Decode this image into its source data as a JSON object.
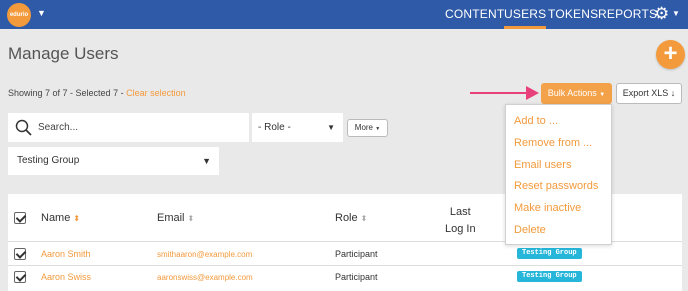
{
  "brand": {
    "logo_text": "edurio",
    "accent": "#f39a3c",
    "nav_bg": "#2f5aa8",
    "tag_color": "#26b6d9"
  },
  "nav": {
    "items": [
      {
        "label": "CONTENT",
        "active": false
      },
      {
        "label": "USERS",
        "active": true
      },
      {
        "label": "TOKENS",
        "active": false
      },
      {
        "label": "REPORTS",
        "active": false
      }
    ],
    "settings_icon": "gear-icon"
  },
  "page": {
    "title": "Manage Users",
    "add_icon": "plus-icon"
  },
  "status": {
    "showing": "Showing 7 of 7 - Selected 7 - ",
    "clear_label": "Clear selection"
  },
  "toolbar": {
    "bulk_label": "Bulk Actions",
    "export_label": "Export XLS"
  },
  "filters": {
    "search_placeholder": "Search...",
    "role_value": "- Role -",
    "more_label": "More",
    "group_value": "Testing Group"
  },
  "bulk_menu": {
    "items": [
      "Add to ...",
      "Remove from ...",
      "Email users",
      "Reset passwords",
      "Make inactive",
      "Delete"
    ]
  },
  "table": {
    "columns": {
      "name": "Name",
      "email": "Email",
      "role": "Role",
      "last_login_1": "Last",
      "last_login_2": "Log In"
    },
    "rows": [
      {
        "name": "Aaron Smith",
        "email": "smithaaron@example.com",
        "role": "Participant",
        "group": "Testing Group",
        "checked": true
      },
      {
        "name": "Aaron Swiss",
        "email": "aaronswiss@example.com",
        "role": "Participant",
        "group": "Testing Group",
        "checked": true
      }
    ]
  }
}
